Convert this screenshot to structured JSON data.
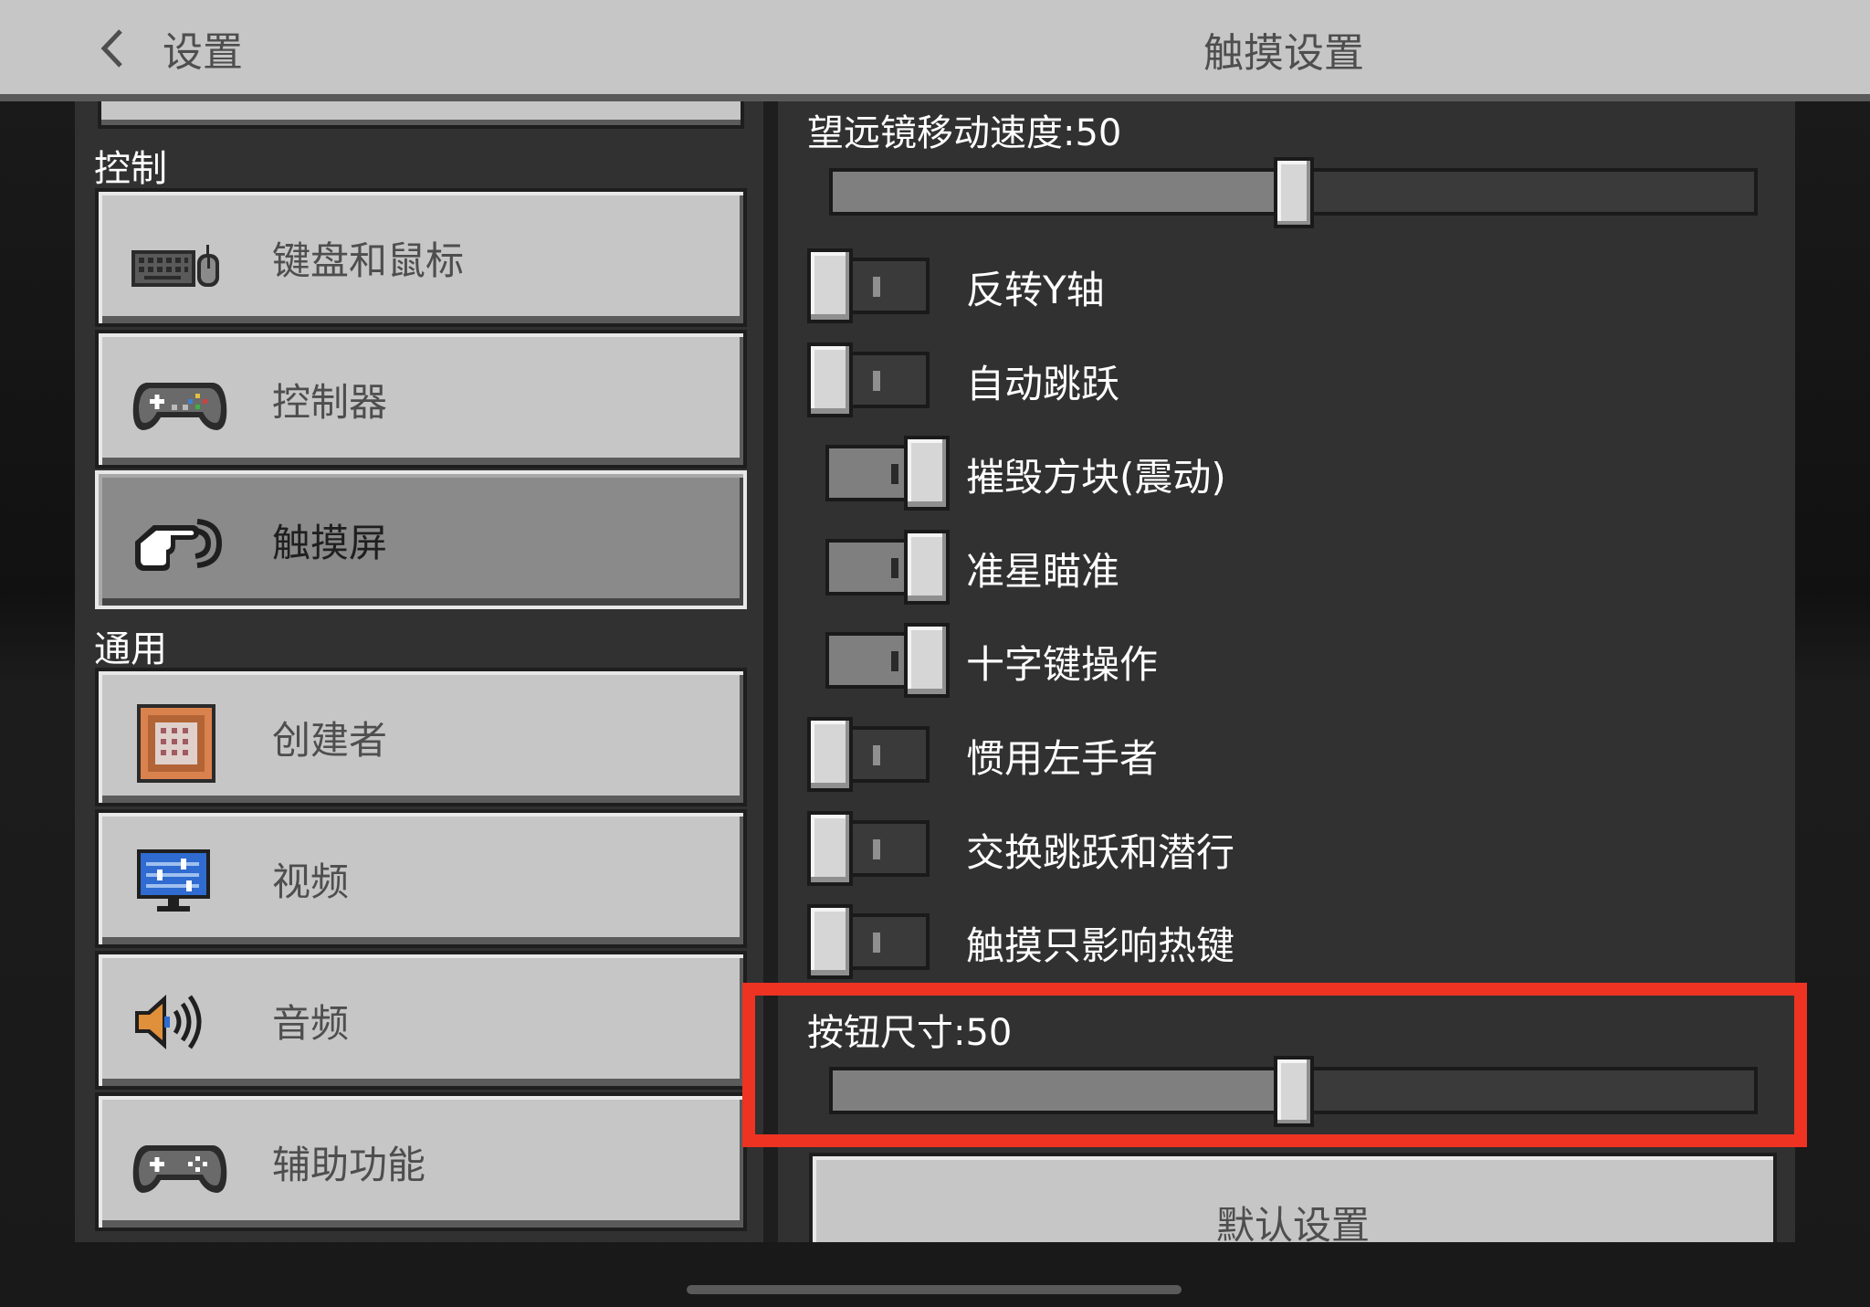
{
  "header": {
    "back_label": "设置",
    "title": "触摸设置"
  },
  "sidebar": {
    "sections": [
      {
        "label": "控制"
      },
      {
        "label": "通用"
      }
    ],
    "items": [
      {
        "label": "键盘和鼠标",
        "icon": "keyboard-mouse-icon"
      },
      {
        "label": "控制器",
        "icon": "controller-icon"
      },
      {
        "label": "触摸屏",
        "icon": "touch-hand-icon",
        "selected": true
      },
      {
        "label": "创建者",
        "icon": "command-block-icon"
      },
      {
        "label": "视频",
        "icon": "monitor-icon"
      },
      {
        "label": "音频",
        "icon": "speaker-icon"
      },
      {
        "label": "辅助功能",
        "icon": "controller-icon"
      }
    ]
  },
  "settings": {
    "telescope_speed": {
      "label": "望远镜移动速度:50",
      "value": 50,
      "min": 0,
      "max": 100
    },
    "toggles": [
      {
        "label": "反转Y轴",
        "on": false
      },
      {
        "label": "自动跳跃",
        "on": false
      },
      {
        "label": "摧毁方块(震动)",
        "on": true
      },
      {
        "label": "准星瞄准",
        "on": true
      },
      {
        "label": "十字键操作",
        "on": true
      },
      {
        "label": "惯用左手者",
        "on": false
      },
      {
        "label": "交换跳跃和潜行",
        "on": false
      },
      {
        "label": "触摸只影响热键",
        "on": false
      }
    ],
    "button_size": {
      "label": "按钮尺寸:50",
      "value": 50,
      "min": 0,
      "max": 100
    },
    "default_button": "默认设置"
  },
  "colors": {
    "highlight": "#ee3322",
    "panel": "#313131",
    "button": "#c6c6c6"
  }
}
